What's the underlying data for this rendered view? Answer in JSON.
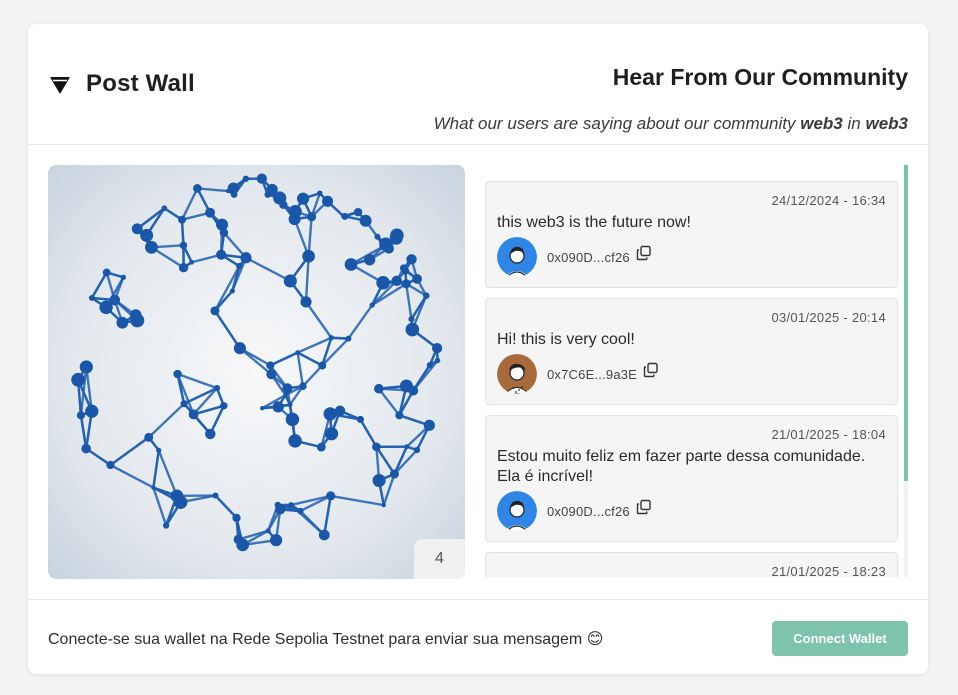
{
  "brand": {
    "title": "Post Wall",
    "icon": "network-logo-icon"
  },
  "hero": {
    "title": "Hear From Our Community",
    "subtitle_prefix": "What our users are saying about our community ",
    "community": "web3",
    "subtitle_mid": " in ",
    "network": "web3"
  },
  "image_panel": {
    "counter": "4"
  },
  "posts": [
    {
      "timestamp": "24/12/2024 - 16:34",
      "message": "this web3 is the future now!",
      "address": "0x090D...cf26",
      "avatar_color": "#2f86e6"
    },
    {
      "timestamp": "03/01/2025 - 20:14",
      "message": "Hi! this is very cool!",
      "address": "0x7C6E...9a3E",
      "avatar_color": "#a8693b"
    },
    {
      "timestamp": "21/01/2025 - 18:04",
      "message": "Estou muito feliz em fazer parte dessa comunidade. Ela é incrível!",
      "address": "0x090D...cf26",
      "avatar_color": "#2f86e6"
    },
    {
      "timestamp": "21/01/2025 - 18:23",
      "message": "",
      "address": "",
      "avatar_color": ""
    }
  ],
  "footer": {
    "note": "Conecte-se sua wallet na Rede Sepolia Testnet para enviar sua mensagem 😊",
    "connect_label": "Connect Wallet"
  },
  "colors": {
    "accent": "#7ec4ad",
    "network_blue": "#1f5fb0"
  }
}
